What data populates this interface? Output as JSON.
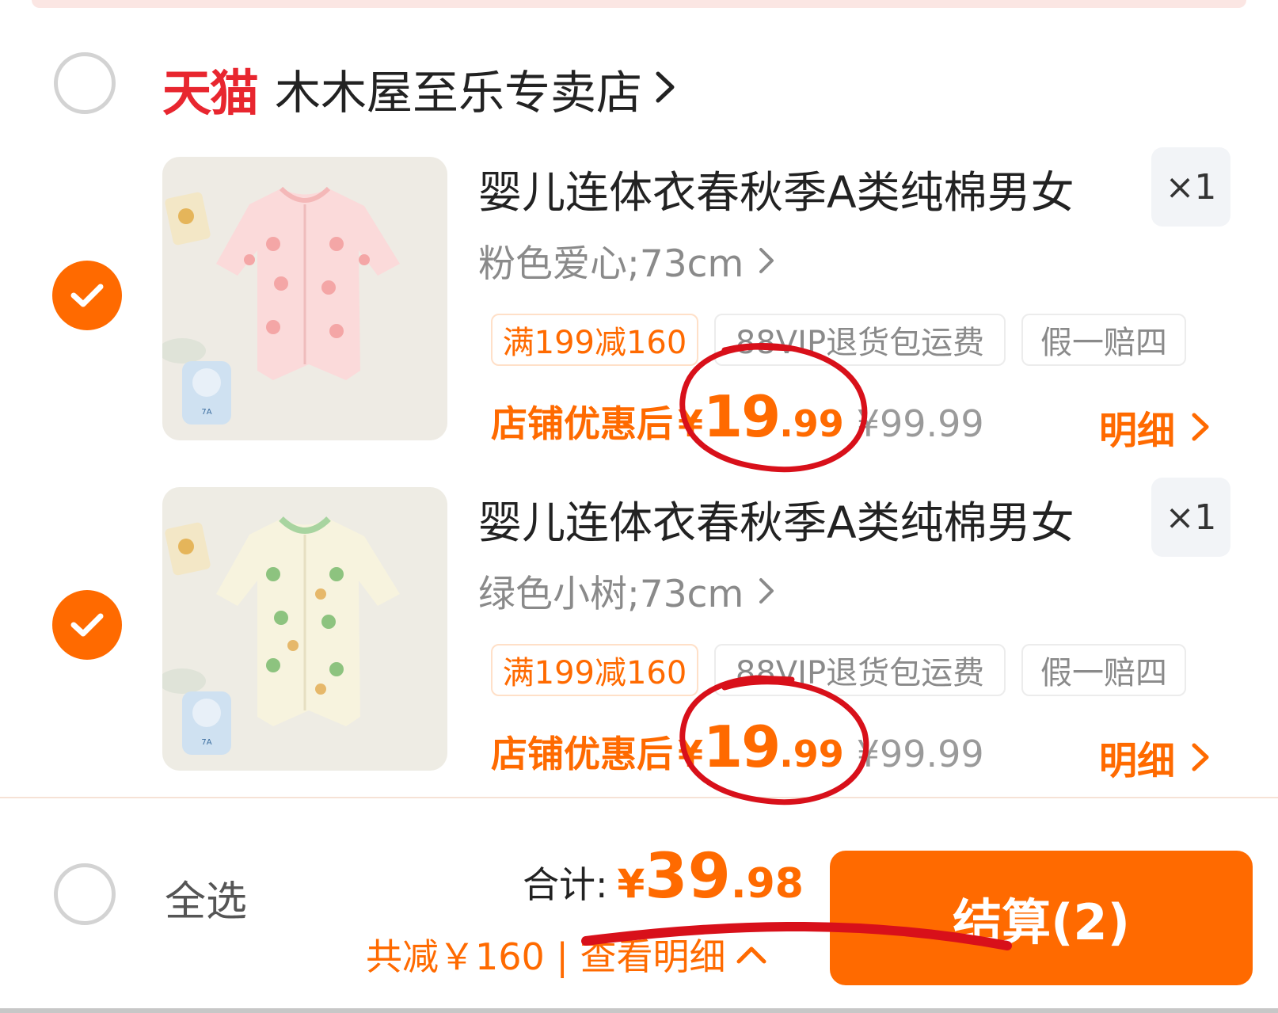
{
  "shop": {
    "platform": "天猫",
    "name": "木木屋至乐专卖店"
  },
  "items": [
    {
      "title": "婴儿连体衣春秋季A类纯棉男女",
      "spec": "粉色爱心;73cm",
      "qty": "×1",
      "tags": [
        "满199减160",
        "88VIP退货包运费",
        "假一赔四"
      ],
      "price_label": "店铺优惠后",
      "price_yen": "¥",
      "price_int": "19",
      "price_dec": ".99",
      "orig_price": "¥99.99",
      "detail": "明细",
      "selected": true,
      "color_theme": "pink"
    },
    {
      "title": "婴儿连体衣春秋季A类纯棉男女",
      "spec": "绿色小树;73cm",
      "qty": "×1",
      "tags": [
        "满199减160",
        "88VIP退货包运费",
        "假一赔四"
      ],
      "price_label": "店铺优惠后",
      "price_yen": "¥",
      "price_int": "19",
      "price_dec": ".99",
      "orig_price": "¥99.99",
      "detail": "明细",
      "selected": true,
      "color_theme": "green"
    }
  ],
  "footer": {
    "select_all": "全选",
    "total_label": "合计:",
    "total_yen": "¥",
    "total_int": "39",
    "total_dec": ".98",
    "savings": "共减￥160 | 查看明细",
    "checkout": "结算(2)"
  },
  "colors": {
    "accent": "#ff6a00",
    "tmall": "#e8262f",
    "annotation": "#d8101a"
  },
  "icons": [
    "check-icon",
    "chevron-right-icon",
    "chevron-up-icon"
  ]
}
